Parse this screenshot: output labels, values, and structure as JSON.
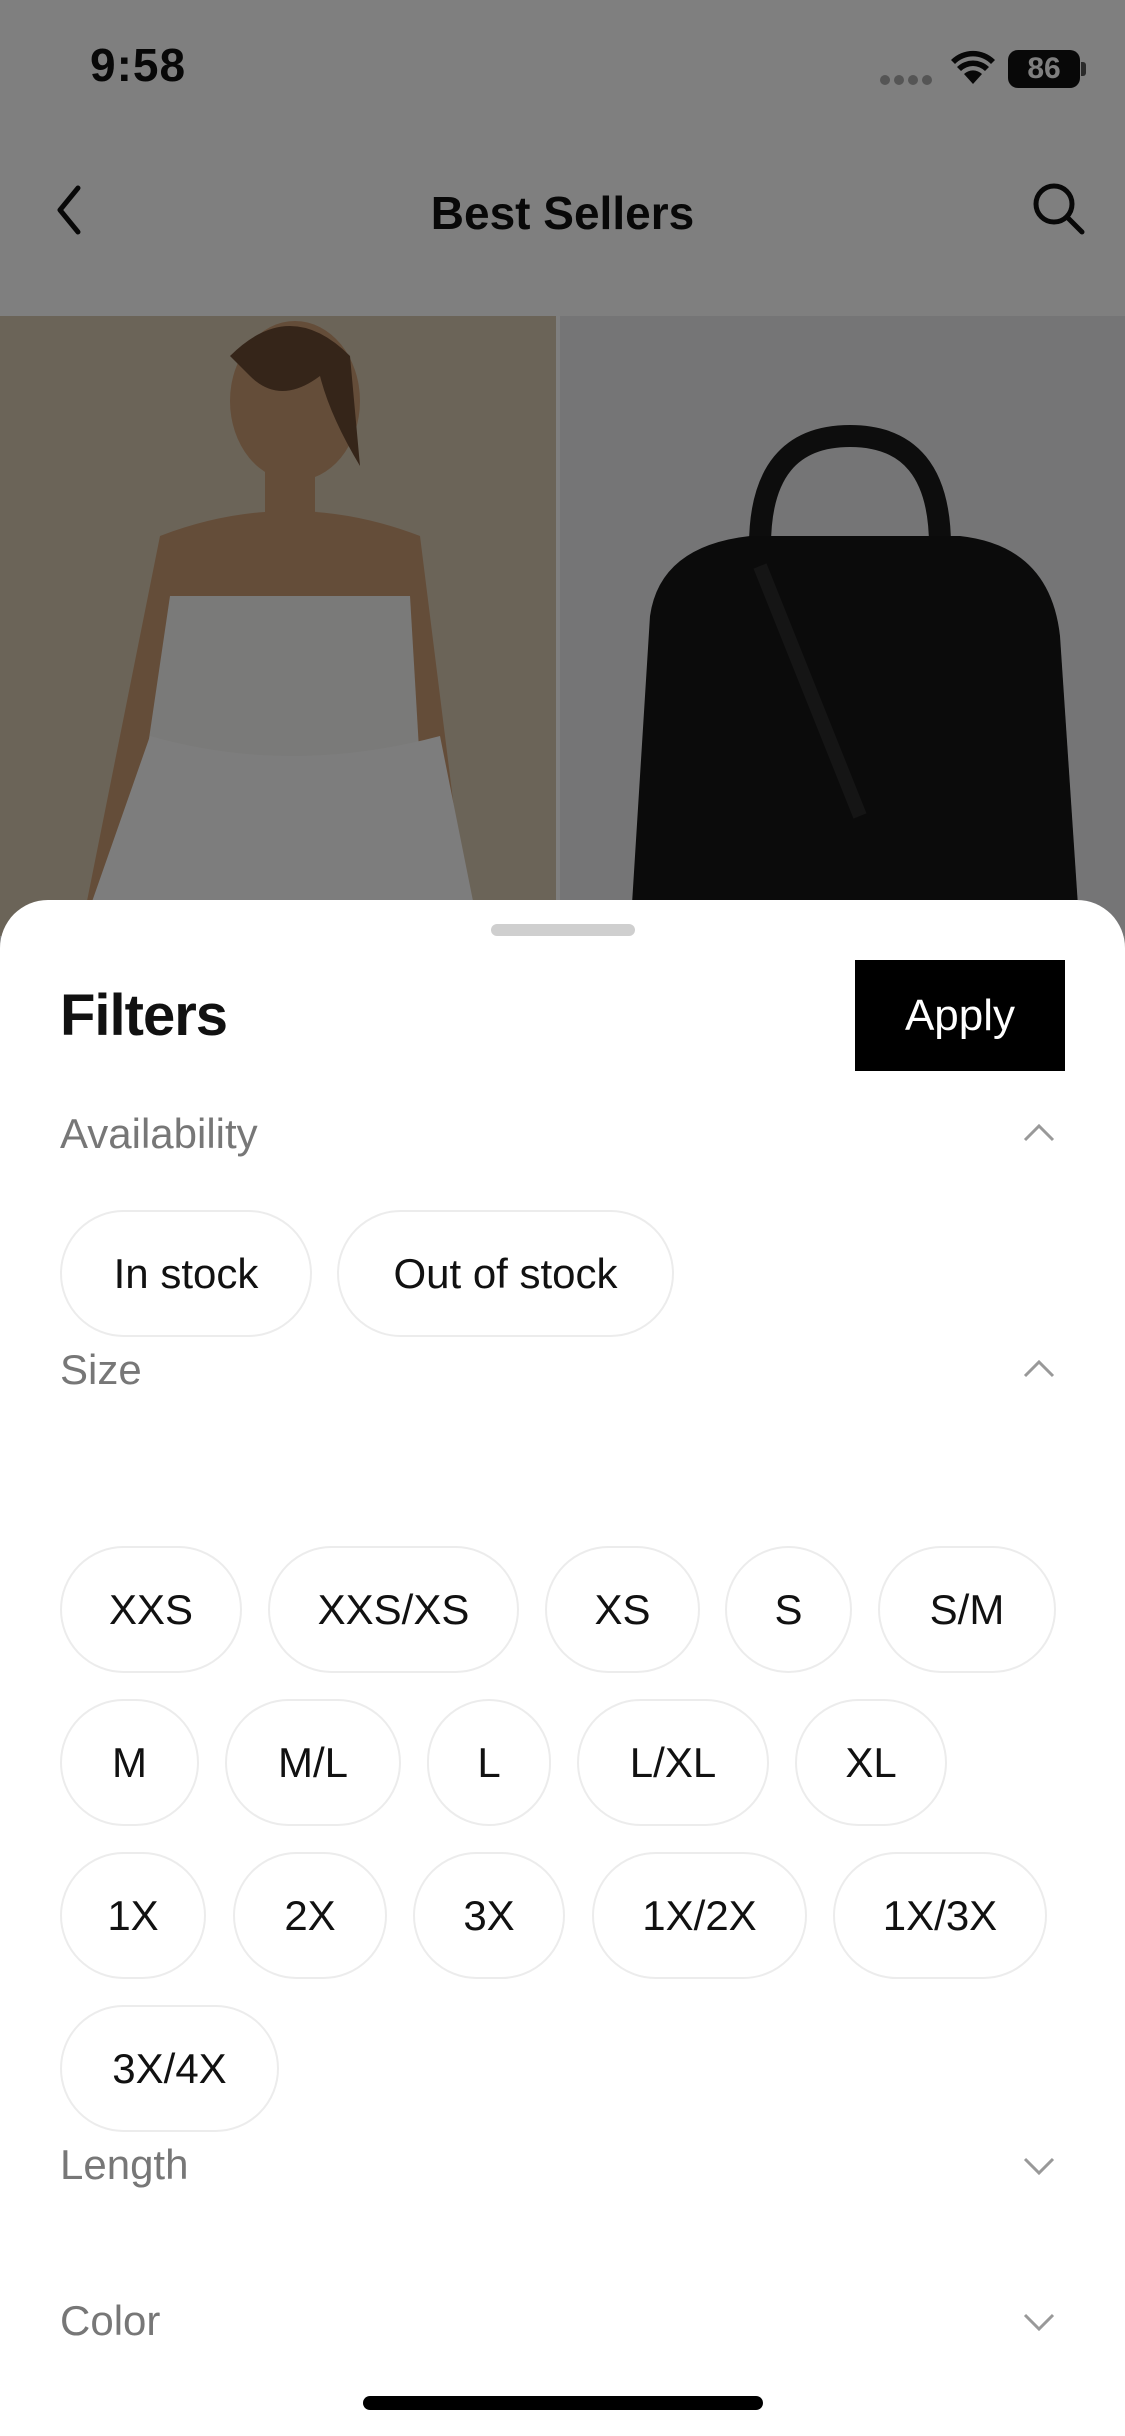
{
  "status_bar": {
    "time": "9:58",
    "battery": "86"
  },
  "nav": {
    "title": "Best Sellers",
    "back_icon": "chevron-left-icon",
    "search_icon": "search-icon"
  },
  "products": [
    {
      "alt": "Product photo: model in white tiered dress"
    },
    {
      "alt": "Product photo: black duffel bag"
    }
  ],
  "sheet": {
    "title": "Filters",
    "apply_label": "Apply",
    "sections": {
      "availability": {
        "title": "Availability",
        "expanded": true,
        "options": [
          "In stock",
          "Out of stock"
        ]
      },
      "size": {
        "title": "Size",
        "expanded": true,
        "options": [
          "XXS",
          "XXS/XS",
          "XS",
          "S",
          "S/M",
          "M",
          "M/L",
          "L",
          "L/XL",
          "XL",
          "1X",
          "2X",
          "3X",
          "1X/2X",
          "1X/3X",
          "3X/4X"
        ]
      },
      "length": {
        "title": "Length",
        "expanded": false
      },
      "color": {
        "title": "Color",
        "expanded": false
      }
    }
  },
  "colors": {
    "overlay": "#000000",
    "apply_bg": "#000000",
    "chip_border": "#ececec",
    "section_title": "#777777"
  }
}
